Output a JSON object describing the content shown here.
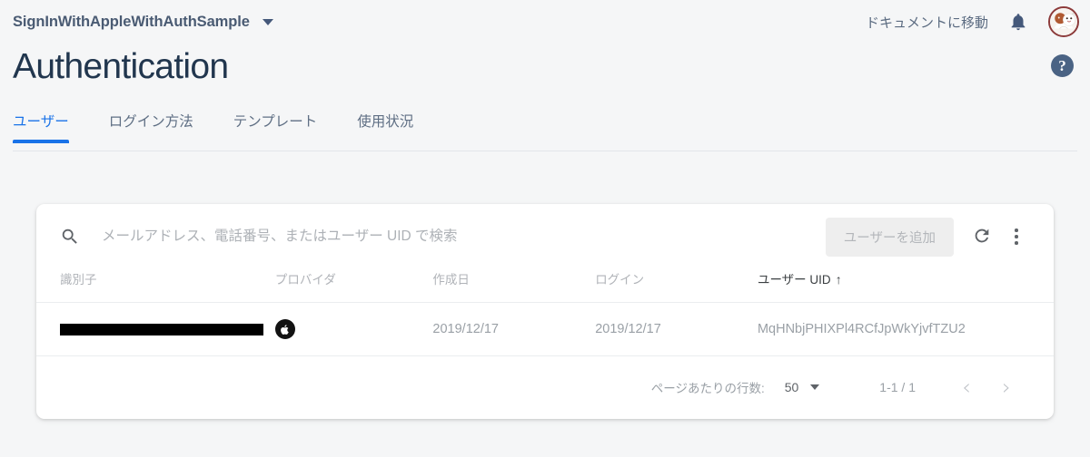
{
  "topbar": {
    "project_name": "SignInWithAppleWithAuthSample",
    "project_caret": "chevron-down-icon",
    "docs_link": "ドキュメントに移動",
    "notifications_icon": "bell-icon",
    "avatar_icon": "user-avatar"
  },
  "header": {
    "title": "Authentication",
    "help_label": "?"
  },
  "tabs": [
    {
      "label": "ユーザー",
      "active": true
    },
    {
      "label": "ログイン方法",
      "active": false
    },
    {
      "label": "テンプレート",
      "active": false
    },
    {
      "label": "使用状況",
      "active": false
    }
  ],
  "toolbar": {
    "search_placeholder": "メールアドレス、電話番号、またはユーザー UID で検索",
    "search_value": "",
    "search_icon": "search-icon",
    "add_user_label": "ユーザーを追加",
    "refresh_icon": "refresh-icon",
    "more_icon": "more-vert-icon"
  },
  "table": {
    "columns": [
      {
        "label": "識別子",
        "sorted": false
      },
      {
        "label": "プロバイダ",
        "sorted": false
      },
      {
        "label": "作成日",
        "sorted": false
      },
      {
        "label": "ログイン",
        "sorted": false
      },
      {
        "label": "ユーザー UID",
        "sorted": true,
        "sort_arrow": "↑"
      }
    ],
    "rows": [
      {
        "identifier": "",
        "identifier_redacted": true,
        "provider": "apple-icon",
        "created": "2019/12/17",
        "signed_in": "2019/12/17",
        "uid": "MqHNbjPHIXPl4RCfJpWkYjvfTZU2"
      }
    ]
  },
  "pagination": {
    "rows_per_page_label": "ページあたりの行数:",
    "rows_per_page_value": "50",
    "rows_caret": "chevron-down-icon",
    "range": "1-1 / 1",
    "prev_label": "‹",
    "next_label": "›"
  },
  "colors": {
    "accent_blue": "#1a73e8",
    "page_bg": "#f5f6f7",
    "title": "#21364e",
    "apple_black": "#121212"
  }
}
